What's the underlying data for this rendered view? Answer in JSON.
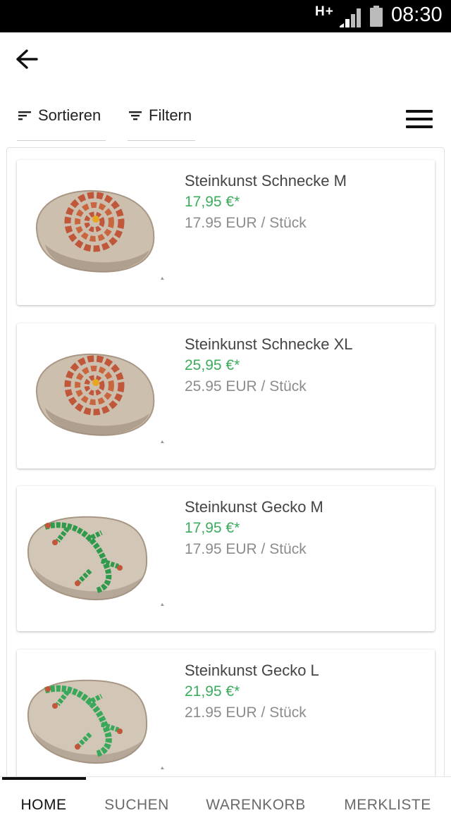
{
  "status_bar": {
    "network": "H+",
    "time": "08:30"
  },
  "toolbar": {
    "sort_label": "Sortieren",
    "filter_label": "Filtern"
  },
  "products": [
    {
      "name": "Steinkunst Schnecke M",
      "price": "17,95 €*",
      "unit_price": "17.95 EUR / Stück",
      "motif": "snail"
    },
    {
      "name": "Steinkunst Schnecke XL",
      "price": "25,95 €*",
      "unit_price": "25.95 EUR / Stück",
      "motif": "snail"
    },
    {
      "name": "Steinkunst Gecko M",
      "price": "17,95 €*",
      "unit_price": "17.95 EUR / Stück",
      "motif": "gecko"
    },
    {
      "name": "Steinkunst Gecko L",
      "price": "21,95 €*",
      "unit_price": "21.95 EUR / Stück",
      "motif": "gecko"
    }
  ],
  "bottom_nav": {
    "tabs": [
      {
        "label": "HOME",
        "active": true
      },
      {
        "label": "SUCHEN",
        "active": false
      },
      {
        "label": "WARENKORB",
        "active": false
      },
      {
        "label": "MERKLISTE",
        "active": false
      }
    ]
  },
  "colors": {
    "price_green": "#3bab5c",
    "unit_grey": "#8c8c8c",
    "status_bar": "#000000"
  }
}
